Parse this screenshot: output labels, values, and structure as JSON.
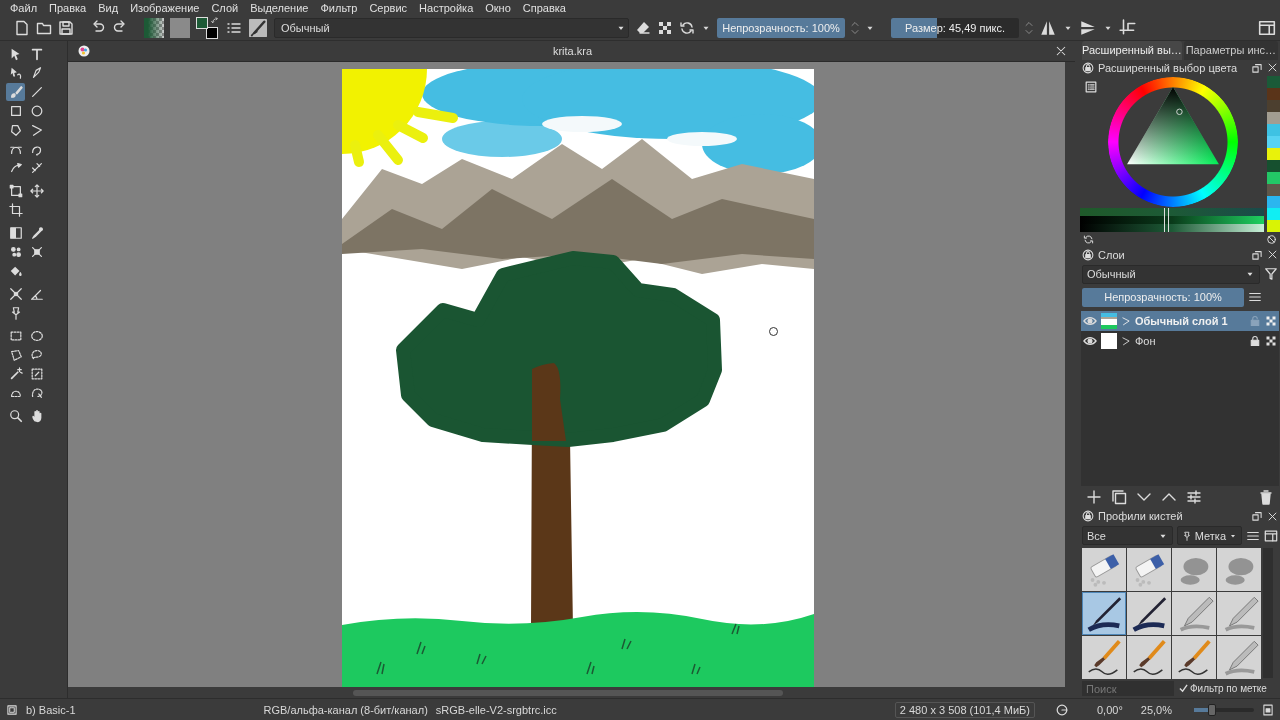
{
  "menu": [
    "Файл",
    "Правка",
    "Вид",
    "Изображение",
    "Слой",
    "Выделение",
    "Фильтр",
    "Сервис",
    "Настройка",
    "Окно",
    "Справка"
  ],
  "toolbar": {
    "foreground": {
      "color": "#1d5a36"
    },
    "background": {
      "color": "#000000"
    },
    "blend_mode": "Обычный",
    "opacity": {
      "label": "Непрозрачность: 100%",
      "level": 1
    },
    "size": {
      "label": "Размер: 45,49 пикс.",
      "level": 0.36
    }
  },
  "toolbox": {
    "groups": [
      [
        {
          "kind": "pointer",
          "selected": false
        },
        {
          "kind": "text",
          "selected": false
        },
        {
          "kind": "shapeedit",
          "selected": false
        },
        {
          "kind": "calligraphy",
          "selected": false
        },
        {
          "kind": "brush",
          "selected": true
        },
        {
          "kind": "line",
          "selected": false
        },
        {
          "kind": "rectangle",
          "selected": false
        },
        {
          "kind": "ellipse",
          "selected": false
        },
        {
          "kind": "polygon",
          "selected": false
        },
        {
          "kind": "polyline",
          "selected": false
        },
        {
          "kind": "bezier",
          "selected": false
        },
        {
          "kind": "freehand",
          "selected": false
        },
        {
          "kind": "dynamic",
          "selected": false
        },
        {
          "kind": "multibrush",
          "selected": false
        }
      ],
      [
        {
          "kind": "transform",
          "selected": false
        },
        {
          "kind": "move",
          "selected": false
        },
        {
          "kind": "crop",
          "selected": false
        }
      ],
      [
        {
          "kind": "gradient",
          "selected": false
        },
        {
          "kind": "picker",
          "selected": false
        },
        {
          "kind": "colorize",
          "selected": false
        },
        {
          "kind": "patch",
          "selected": false
        },
        {
          "kind": "fill",
          "selected": false
        }
      ],
      [
        {
          "kind": "assistant",
          "selected": false
        },
        {
          "kind": "measure",
          "selected": false
        },
        {
          "kind": "reference",
          "selected": false
        }
      ],
      [
        {
          "kind": "rectselect",
          "selected": false
        },
        {
          "kind": "ellipseselect",
          "selected": false
        },
        {
          "kind": "polyselect",
          "selected": false
        },
        {
          "kind": "lassoselect",
          "selected": false
        },
        {
          "kind": "wandselect",
          "selected": false
        },
        {
          "kind": "similarselect",
          "selected": false
        },
        {
          "kind": "bezierselect",
          "selected": false
        },
        {
          "kind": "magneticselect",
          "selected": false
        }
      ],
      [
        {
          "kind": "zoom",
          "selected": false
        },
        {
          "kind": "pan",
          "selected": false
        }
      ]
    ]
  },
  "document": {
    "title": "krita.kra"
  },
  "dock": {
    "tabs": [
      {
        "label": "Расширенный вы…",
        "selected": true
      },
      {
        "label": "Параметры инс…",
        "selected": false
      }
    ],
    "color_selector": {
      "title": "Расширенный выбор цвета",
      "swatches": [
        {
          "color": "#1b5a38"
        },
        {
          "color": "#5a3419"
        },
        {
          "color": "#4c3f2f"
        },
        {
          "color": "#a29d91"
        },
        {
          "color": "#3ec2e3"
        },
        {
          "color": "#57d3f2"
        },
        {
          "color": "#e9f20a"
        },
        {
          "color": "#16502f"
        },
        {
          "color": "#23c766"
        },
        {
          "color": "#5f574a"
        },
        {
          "color": "#2bb6ef"
        },
        {
          "color": "#10eef3"
        },
        {
          "color": "#d9f305"
        }
      ],
      "sliders": [
        {
          "level": 0.47
        },
        {
          "level": 0.47
        },
        {
          "level": 0.47
        }
      ]
    },
    "layers": {
      "title": "Слои",
      "blend_mode": "Обычный",
      "opacity": {
        "label": "Непрозрачность: 100%",
        "level": 1
      },
      "items": [
        {
          "name": "Обычный слой 1",
          "selected": true,
          "visible": true,
          "locked": false,
          "kind": "painting"
        },
        {
          "name": "Фон",
          "selected": false,
          "visible": true,
          "locked": true,
          "kind": "blank"
        }
      ]
    },
    "brushes": {
      "title": "Профили кистей",
      "filter": "Все",
      "tag": "Метка",
      "presets": [
        {
          "kind": "eraser",
          "selected": false
        },
        {
          "kind": "eraser",
          "selected": false
        },
        {
          "kind": "airbrush",
          "selected": false
        },
        {
          "kind": "airbrush",
          "selected": false
        },
        {
          "kind": "pen",
          "selected": true
        },
        {
          "kind": "pen",
          "selected": false
        },
        {
          "kind": "pencil",
          "selected": false
        },
        {
          "kind": "pencil",
          "selected": false
        },
        {
          "kind": "brush",
          "selected": false
        },
        {
          "kind": "brush",
          "selected": false
        },
        {
          "kind": "brush",
          "selected": false
        },
        {
          "kind": "pencil",
          "selected": false
        }
      ],
      "search_placeholder": "Поиск",
      "tag_filter": {
        "label": "Фильтр по метке",
        "checked": true
      }
    }
  },
  "status_bar": {
    "preset": "b) Basic-1",
    "color_space": "RGB/альфа-канал (8-бит/канал)",
    "profile": "sRGB-elle-V2-srgbtrc.icc",
    "image_size": "2 480 x 3 508 (101,4 МиБ)",
    "rotation": "0,00°",
    "zoom": {
      "label": "25,0%",
      "level": 0.3
    }
  }
}
